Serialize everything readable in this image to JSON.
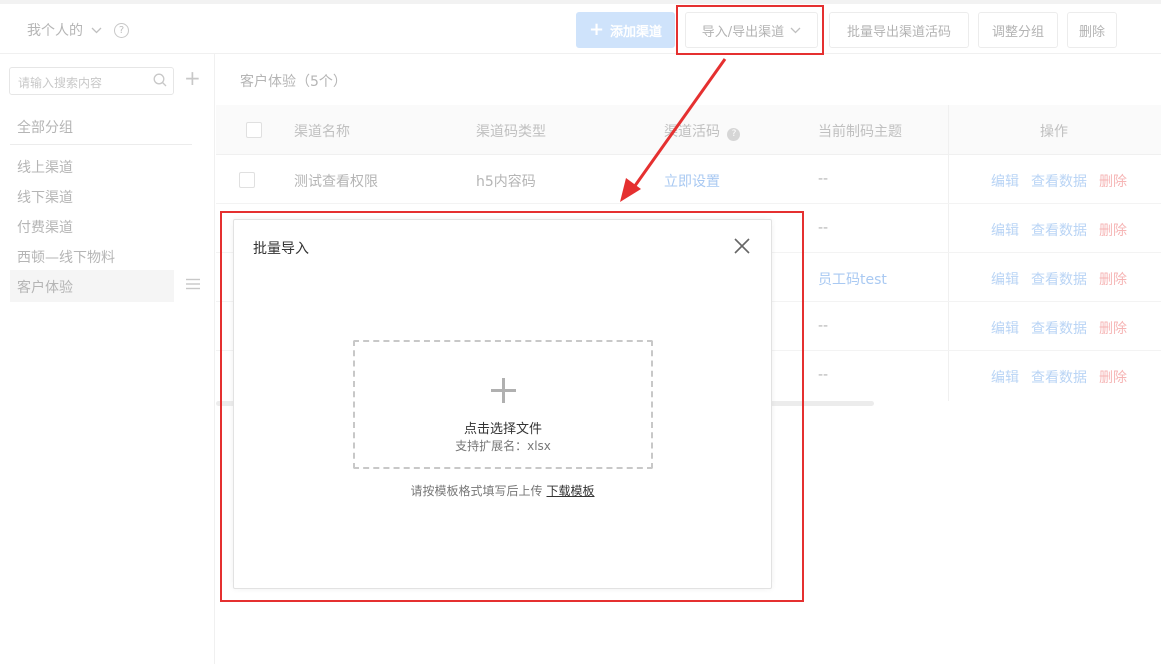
{
  "header": {
    "scope_label": "我个人的",
    "help_glyph": "?",
    "add_channel": "添加渠道",
    "import_export": "导入/导出渠道",
    "batch_export_codes": "批量导出渠道活码",
    "adjust_group": "调整分组",
    "delete": "删除"
  },
  "sidebar": {
    "search_placeholder": "请输入搜索内容",
    "all_groups": "全部分组",
    "groups": [
      "线上渠道",
      "线下渠道",
      "付费渠道",
      "西顿—线下物料",
      "客户体验"
    ],
    "active_group": "客户体验"
  },
  "main": {
    "breadcrumb": "客户体验（5个）",
    "columns": [
      "渠道名称",
      "渠道码类型",
      "渠道活码",
      "当前制码主题",
      "操作"
    ],
    "rows": [
      {
        "name": "测试查看权限",
        "type": "h5内容码",
        "code": "立即设置",
        "theme": "--"
      },
      {
        "name": "",
        "type": "",
        "code": "",
        "theme": "--"
      },
      {
        "name": "",
        "type": "",
        "code": "",
        "theme": "员工码test"
      },
      {
        "name": "",
        "type": "",
        "code": "",
        "theme": "--"
      },
      {
        "name": "",
        "type": "",
        "code": "",
        "theme": "--"
      }
    ],
    "ops": {
      "edit": "编辑",
      "view": "查看数据",
      "delete": "删除"
    }
  },
  "modal": {
    "title": "批量导入",
    "upload_label": "点击选择文件",
    "upload_ext": "支持扩展名：xlsx",
    "hint": "请按模板格式填写后上传",
    "download_template": "下载模板"
  },
  "colors": {
    "annotation": "#e53030",
    "primary_washed": "#cfe3fb",
    "link_washed": "#b9d4f5",
    "danger_washed": "#f6b5b5"
  }
}
